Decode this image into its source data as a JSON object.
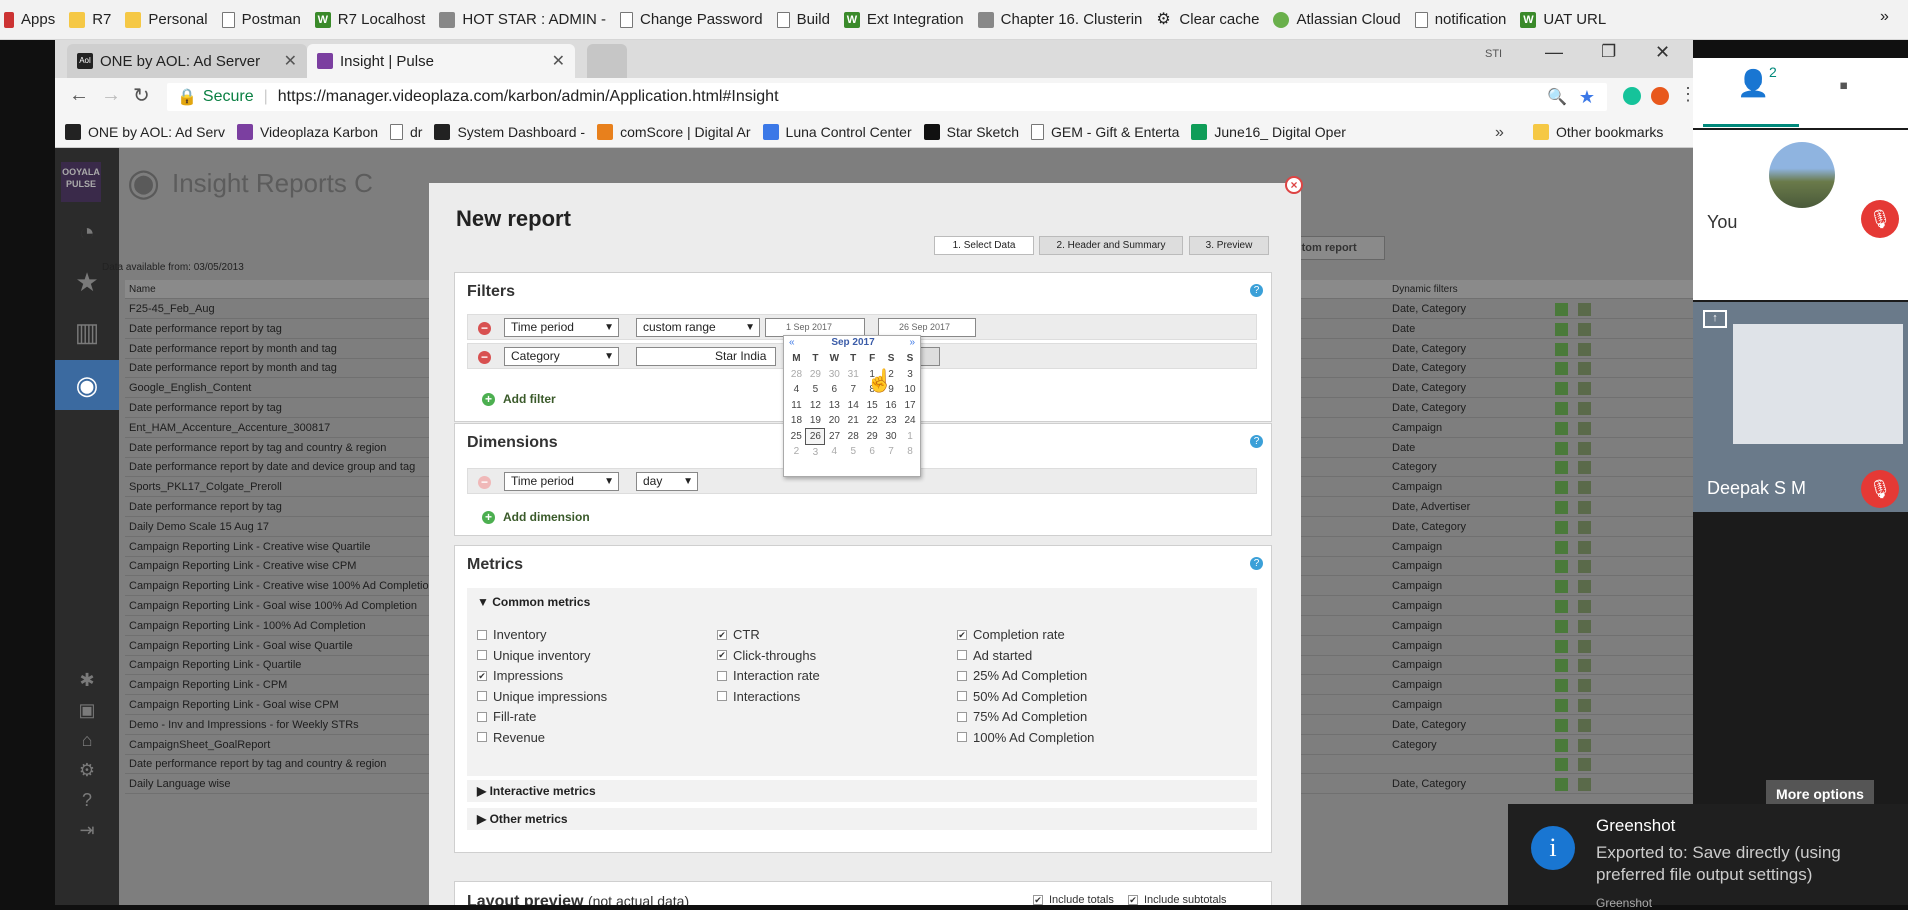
{
  "bookmarks_top": [
    {
      "label": "Apps",
      "icon": "apps-grid-icon"
    },
    {
      "label": "R7",
      "icon": "folder-icon"
    },
    {
      "label": "Personal",
      "icon": "folder-icon"
    },
    {
      "label": "Postman",
      "icon": "page-icon"
    },
    {
      "label": "R7 Localhost",
      "icon": "w-icon"
    },
    {
      "label": "HOT STAR : ADMIN -",
      "icon": "site-icon"
    },
    {
      "label": "Change Password",
      "icon": "page-icon"
    },
    {
      "label": "Build",
      "icon": "page-icon"
    },
    {
      "label": "Ext Integration",
      "icon": "w-icon"
    },
    {
      "label": "Chapter 16. Clusterin",
      "icon": "site-icon"
    },
    {
      "label": "Clear cache",
      "icon": "gear-icon"
    },
    {
      "label": "Atlassian Cloud",
      "icon": "globe-icon"
    },
    {
      "label": "notification",
      "icon": "page-icon"
    },
    {
      "label": "UAT URL",
      "icon": "w-icon"
    }
  ],
  "bookmarks_top_more": "»",
  "tabs": [
    {
      "label": "ONE by AOL: Ad Server",
      "active": false
    },
    {
      "label": "Insight | Pulse",
      "active": true
    }
  ],
  "window_controls": {
    "minimize": "—",
    "restore": "❐",
    "close": "✕"
  },
  "url": {
    "secure": "Secure",
    "address": "https://manager.videoplaza.com/karbon/admin/Application.html#Insight"
  },
  "bookmarks_bar": [
    {
      "label": "ONE by AOL: Ad Serv"
    },
    {
      "label": "Videoplaza Karbon"
    },
    {
      "label": "dr"
    },
    {
      "label": "System Dashboard -"
    },
    {
      "label": "comScore | Digital Ar"
    },
    {
      "label": "Luna Control Center"
    },
    {
      "label": "Star Sketch"
    },
    {
      "label": "GEM - Gift & Enterta"
    },
    {
      "label": "June16_ Digital Oper"
    }
  ],
  "bookmarks_bar_more": "»",
  "other_bookmarks": "Other bookmarks",
  "app": {
    "logo": "OOYALA PULSE",
    "title": "Insight Reports C",
    "data_available": "Data available from: 03/05/2013",
    "new_custom_report": "New custom report",
    "col_name": "Name",
    "col_dynamic": "Dynamic filters",
    "rows": [
      {
        "name": "F25-45_Feb_Aug",
        "dyn": "Date, Category"
      },
      {
        "name": "Date performance report by tag",
        "dyn": "Date"
      },
      {
        "name": "Date performance report by month and tag",
        "dyn": "Date, Category"
      },
      {
        "name": "Date performance report by month and tag",
        "dyn": "Date, Category"
      },
      {
        "name": "Google_English_Content",
        "dyn": "Date, Category"
      },
      {
        "name": "Date performance report by tag",
        "dyn": "Date, Category"
      },
      {
        "name": "Ent_HAM_Accenture_Accenture_300817",
        "dyn": "Campaign"
      },
      {
        "name": "Date performance report by tag and country & region",
        "dyn": "Date"
      },
      {
        "name": "Date performance report by date and device group and tag",
        "dyn": "Category"
      },
      {
        "name": "Sports_PKL17_Colgate_Preroll",
        "dyn": "Campaign"
      },
      {
        "name": "Date performance report by tag",
        "dyn": "Date, Advertiser"
      },
      {
        "name": "Daily Demo Scale 15 Aug 17",
        "dyn": "Date, Category"
      },
      {
        "name": "Campaign Reporting Link - Creative wise Quartile",
        "dyn": "Campaign"
      },
      {
        "name": "Campaign Reporting Link - Creative wise CPM",
        "dyn": "Campaign"
      },
      {
        "name": "Campaign Reporting Link - Creative wise 100% Ad Completion",
        "dyn": "Campaign"
      },
      {
        "name": "Campaign Reporting Link - Goal wise 100% Ad Completion",
        "dyn": "Campaign"
      },
      {
        "name": "Campaign Reporting Link - 100% Ad Completion",
        "dyn": "Campaign"
      },
      {
        "name": "Campaign Reporting Link - Goal wise Quartile",
        "dyn": "Campaign"
      },
      {
        "name": "Campaign Reporting Link - Quartile",
        "dyn": "Campaign"
      },
      {
        "name": "Campaign Reporting Link - CPM",
        "dyn": "Campaign"
      },
      {
        "name": "Campaign Reporting Link - Goal wise CPM",
        "dyn": "Campaign"
      },
      {
        "name": "Demo - Inv and Impressions - for Weekly STRs",
        "dyn": "Date, Category"
      },
      {
        "name": "CampaignSheet_GoalReport",
        "dyn": "Category"
      },
      {
        "name": "Date performance report by tag and country & region",
        "dyn": ""
      },
      {
        "name": "Daily Language wise",
        "dyn": "Date, Category"
      }
    ]
  },
  "modal": {
    "title": "New report",
    "steps": [
      "1. Select Data",
      "2. Header and Summary",
      "3. Preview"
    ],
    "filters": {
      "heading": "Filters",
      "row1": {
        "field": "Time period",
        "mode": "custom range",
        "from": "1 Sep 2017",
        "to": "26 Sep 2017"
      },
      "row2": {
        "field": "Category",
        "value": "Star India",
        "path_btn": "Path"
      },
      "add": "Add filter"
    },
    "dimensions": {
      "heading": "Dimensions",
      "field": "Time period",
      "granularity": "day",
      "add": "Add dimension"
    },
    "metrics": {
      "heading": "Metrics",
      "common": "Common metrics",
      "col1": [
        {
          "label": "Inventory",
          "checked": false
        },
        {
          "label": "Unique inventory",
          "checked": false
        },
        {
          "label": "Impressions",
          "checked": true
        },
        {
          "label": "Unique impressions",
          "checked": false
        },
        {
          "label": "Fill-rate",
          "checked": false
        },
        {
          "label": "Revenue",
          "checked": false
        }
      ],
      "col2": [
        {
          "label": "CTR",
          "checked": true
        },
        {
          "label": "Click-throughs",
          "checked": true
        },
        {
          "label": "Interaction rate",
          "checked": false
        },
        {
          "label": "Interactions",
          "checked": false
        }
      ],
      "col3": [
        {
          "label": "Completion rate",
          "checked": true
        },
        {
          "label": "Ad started",
          "checked": false
        },
        {
          "label": "25% Ad Completion",
          "checked": false
        },
        {
          "label": "50% Ad Completion",
          "checked": false
        },
        {
          "label": "75% Ad Completion",
          "checked": false
        },
        {
          "label": "100% Ad Completion",
          "checked": false
        }
      ],
      "interactive": "Interactive metrics",
      "other": "Other metrics"
    },
    "layout": {
      "heading": "Layout preview",
      "note": "(not actual data)",
      "include_totals": "Include totals",
      "include_subtotals": "Include subtotals"
    }
  },
  "calendar": {
    "prev": "«",
    "next": "»",
    "month": "Sep 2017",
    "weekdays": [
      "M",
      "T",
      "W",
      "T",
      "F",
      "S",
      "S"
    ],
    "weeks": [
      [
        "28",
        "29",
        "30",
        "31",
        "1",
        "2",
        "3"
      ],
      [
        "4",
        "5",
        "6",
        "7",
        "8",
        "9",
        "10"
      ],
      [
        "11",
        "12",
        "13",
        "14",
        "15",
        "16",
        "17"
      ],
      [
        "18",
        "19",
        "20",
        "21",
        "22",
        "23",
        "24"
      ],
      [
        "25",
        "26",
        "27",
        "28",
        "29",
        "30",
        "1"
      ],
      [
        "2",
        "3",
        "4",
        "5",
        "6",
        "7",
        "8"
      ]
    ],
    "selected": "26"
  },
  "meet": {
    "participants_count": "2",
    "you_label": "You",
    "other_name": "Deepak S M",
    "more_options": "More options"
  },
  "toast": {
    "title": "Greenshot",
    "message": "Exported to: Save directly (using preferred file output settings)",
    "footer": "Greenshot"
  },
  "colors": {
    "accent": "#3ba0d8",
    "danger": "#d85050",
    "add": "#4caf50",
    "meet_teal": "#00897b",
    "mic_off": "#e53935"
  }
}
